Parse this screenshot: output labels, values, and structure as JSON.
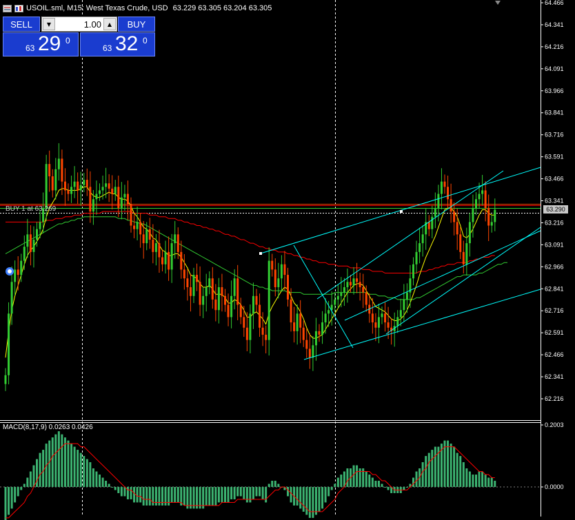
{
  "header": {
    "symbol_line": "USOIL.sml, M15:  West Texas Crude, USD",
    "ohlc": "63.229 63.305 63.204 63.305",
    "icons": [
      "one-click-trading-icon",
      "symbol-icon"
    ]
  },
  "trade_panel": {
    "sell_label": "SELL",
    "buy_label": "BUY",
    "lot_value": "1.00",
    "sell_price_small": "63",
    "sell_price_big": "29",
    "sell_price_sup": "0",
    "buy_price_small": "63",
    "buy_price_big": "32",
    "buy_price_sup": "0"
  },
  "position_label": "BUY 1 at 63.269",
  "current_price_tag": "63.290",
  "macd_label": "MACD(8,17,9) 0.0263 0.0426",
  "colors": {
    "bull": "#32cd32",
    "bear": "#ff4500",
    "ma_fast": "#ffff00",
    "ma_mid": "#ff0000",
    "ma_slow": "#32cd32",
    "trendline": "#00ffff",
    "panel_blue": "#1a3ccf"
  },
  "chart_data": [
    {
      "type": "candlestick",
      "title": "USOIL.sml, M15",
      "y_ticks": [
        "64.466",
        "64.341",
        "64.216",
        "64.091",
        "63.966",
        "63.841",
        "63.716",
        "63.591",
        "63.466",
        "63.341",
        "63.216",
        "63.091",
        "62.966",
        "62.841",
        "62.716",
        "62.591",
        "62.466",
        "62.341",
        "62.216"
      ],
      "ylim": [
        62.19,
        64.47
      ],
      "closes": [
        62.35,
        62.7,
        62.88,
        62.95,
        62.92,
        63.0,
        63.08,
        63.15,
        63.05,
        63.12,
        63.18,
        63.22,
        63.3,
        63.55,
        63.48,
        63.4,
        63.52,
        63.58,
        63.45,
        63.4,
        63.38,
        63.42,
        63.45,
        63.4,
        63.43,
        63.46,
        63.42,
        63.28,
        63.35,
        63.38,
        63.4,
        63.42,
        63.44,
        63.41,
        63.38,
        63.42,
        63.3,
        63.36,
        63.38,
        63.32,
        63.2,
        63.18,
        63.22,
        63.15,
        63.1,
        63.18,
        63.12,
        63.05,
        63.1,
        63.02,
        62.98,
        63.05,
        62.95,
        63.1,
        63.15,
        63.05,
        62.95,
        62.9,
        62.85,
        62.8,
        62.92,
        62.88,
        62.75,
        62.8,
        62.85,
        62.9,
        62.78,
        62.72,
        62.85,
        62.8,
        62.75,
        62.68,
        62.8,
        62.9,
        62.75,
        62.68,
        62.62,
        62.55,
        62.7,
        62.8,
        62.75,
        62.62,
        62.58,
        62.55,
        63.0,
        62.95,
        62.85,
        62.9,
        62.98,
        62.92,
        62.78,
        62.65,
        62.6,
        62.7,
        62.62,
        62.55,
        62.5,
        62.45,
        62.52,
        62.6,
        62.58,
        62.65,
        62.7,
        62.72,
        62.75,
        62.78,
        62.8,
        62.82,
        62.85,
        62.88,
        62.86,
        62.9,
        62.88,
        62.85,
        62.82,
        62.75,
        62.7,
        62.65,
        62.62,
        62.68,
        62.7,
        62.65,
        62.62,
        62.6,
        62.63,
        62.68,
        62.72,
        62.78,
        62.82,
        62.9,
        62.98,
        63.05,
        63.1,
        63.15,
        63.22,
        63.18,
        63.25,
        63.3,
        63.38,
        63.45,
        63.42,
        63.35,
        63.28,
        63.22,
        63.15,
        63.05,
        62.98,
        63.1,
        63.22,
        63.3,
        63.35,
        63.38,
        63.4,
        63.3,
        63.2,
        63.22,
        63.29
      ],
      "ma_fast": [
        62.45,
        62.6,
        62.72,
        62.8,
        62.86,
        62.92,
        62.98,
        63.03,
        63.06,
        63.08,
        63.11,
        63.14,
        63.18,
        63.25,
        63.3,
        63.33,
        63.36,
        63.4,
        63.41,
        63.41,
        63.4,
        63.4,
        63.4,
        63.4,
        63.41,
        63.42,
        63.42,
        63.39,
        63.37,
        63.36,
        63.36,
        63.37,
        63.38,
        63.39,
        63.38,
        63.38,
        63.36,
        63.35,
        63.35,
        63.34,
        63.31,
        63.27,
        63.25,
        63.22,
        63.19,
        63.18,
        63.16,
        63.13,
        63.12,
        63.09,
        63.06,
        63.05,
        63.03,
        63.03,
        63.04,
        63.04,
        63.02,
        62.99,
        62.96,
        62.92,
        62.91,
        62.9,
        62.87,
        62.85,
        62.85,
        62.86,
        62.84,
        62.81,
        62.81,
        62.81,
        62.79,
        62.76,
        62.76,
        62.78,
        62.77,
        62.75,
        62.72,
        62.68,
        62.68,
        62.7,
        62.71,
        62.69,
        62.67,
        62.64,
        62.7,
        62.74,
        62.77,
        62.8,
        62.83,
        62.85,
        62.84,
        62.8,
        62.76,
        62.74,
        62.71,
        62.67,
        62.62,
        62.58,
        62.56,
        62.56,
        62.57,
        62.58,
        62.61,
        62.64,
        62.67,
        62.7,
        62.73,
        62.76,
        62.79,
        62.82,
        62.84,
        62.86,
        62.87,
        62.87,
        62.86,
        62.83,
        62.8,
        62.77,
        62.74,
        62.73,
        62.72,
        62.71,
        62.69,
        62.67,
        62.66,
        62.66,
        62.67,
        62.69,
        62.72,
        62.76,
        62.81,
        62.86,
        62.92,
        62.97,
        63.02,
        63.06,
        63.1,
        63.14,
        63.19,
        63.24,
        63.29,
        63.3,
        63.3,
        63.28,
        63.25,
        63.2,
        63.14,
        63.13,
        63.15,
        63.18,
        63.22,
        63.26,
        63.29,
        63.29,
        63.27,
        63.26,
        63.26
      ],
      "ma_mid": [
        63.22,
        63.22,
        63.22,
        63.22,
        63.22,
        63.22,
        63.22,
        63.22,
        63.22,
        63.22,
        63.22,
        63.22,
        63.22,
        63.23,
        63.23,
        63.23,
        63.24,
        63.24,
        63.24,
        63.25,
        63.25,
        63.25,
        63.26,
        63.26,
        63.26,
        63.27,
        63.27,
        63.27,
        63.27,
        63.27,
        63.27,
        63.28,
        63.28,
        63.28,
        63.28,
        63.28,
        63.28,
        63.28,
        63.28,
        63.28,
        63.28,
        63.27,
        63.27,
        63.27,
        63.27,
        63.27,
        63.26,
        63.26,
        63.26,
        63.25,
        63.25,
        63.25,
        63.24,
        63.24,
        63.24,
        63.23,
        63.23,
        63.22,
        63.22,
        63.21,
        63.21,
        63.2,
        63.2,
        63.19,
        63.19,
        63.18,
        63.18,
        63.17,
        63.17,
        63.16,
        63.15,
        63.15,
        63.14,
        63.14,
        63.13,
        63.12,
        63.12,
        63.11,
        63.1,
        63.1,
        63.09,
        63.08,
        63.08,
        63.07,
        63.07,
        63.06,
        63.06,
        63.05,
        63.05,
        63.05,
        63.04,
        63.04,
        63.03,
        63.03,
        63.02,
        63.02,
        63.01,
        63.01,
        63.0,
        63.0,
        62.99,
        62.99,
        62.99,
        62.98,
        62.98,
        62.98,
        62.97,
        62.97,
        62.97,
        62.97,
        62.96,
        62.96,
        62.96,
        62.96,
        62.95,
        62.95,
        62.95,
        62.94,
        62.94,
        62.94,
        62.94,
        62.93,
        62.93,
        62.93,
        62.93,
        62.93,
        62.93,
        62.93,
        62.93,
        62.93,
        62.93,
        62.93,
        62.94,
        62.94,
        62.94,
        62.95,
        62.95,
        62.96,
        62.96,
        62.97,
        62.97,
        62.98,
        62.98,
        62.98,
        62.99,
        62.99,
        62.99,
        62.99,
        63.0,
        63.0,
        63.01,
        63.01,
        63.02,
        63.02,
        63.02,
        63.03,
        63.03
      ],
      "ma_slow": [
        63.04,
        63.05,
        63.06,
        63.07,
        63.08,
        63.09,
        63.1,
        63.11,
        63.12,
        63.13,
        63.14,
        63.15,
        63.16,
        63.17,
        63.18,
        63.19,
        63.2,
        63.21,
        63.21,
        63.22,
        63.22,
        63.23,
        63.23,
        63.24,
        63.24,
        63.25,
        63.25,
        63.25,
        63.25,
        63.25,
        63.25,
        63.25,
        63.25,
        63.25,
        63.25,
        63.25,
        63.24,
        63.24,
        63.24,
        63.23,
        63.23,
        63.22,
        63.22,
        63.21,
        63.21,
        63.2,
        63.19,
        63.18,
        63.17,
        63.16,
        63.15,
        63.14,
        63.13,
        63.12,
        63.11,
        63.1,
        63.09,
        63.08,
        63.07,
        63.06,
        63.05,
        63.04,
        63.03,
        63.02,
        63.01,
        63.0,
        62.99,
        62.98,
        62.97,
        62.96,
        62.95,
        62.94,
        62.93,
        62.92,
        62.91,
        62.9,
        62.89,
        62.88,
        62.87,
        62.86,
        62.86,
        62.85,
        62.85,
        62.84,
        62.84,
        62.83,
        62.83,
        62.83,
        62.83,
        62.83,
        62.82,
        62.82,
        62.82,
        62.82,
        62.82,
        62.81,
        62.81,
        62.81,
        62.81,
        62.81,
        62.81,
        62.81,
        62.81,
        62.81,
        62.81,
        62.82,
        62.82,
        62.82,
        62.82,
        62.82,
        62.82,
        62.82,
        62.82,
        62.82,
        62.82,
        62.82,
        62.81,
        62.81,
        62.81,
        62.8,
        62.8,
        62.8,
        62.79,
        62.79,
        62.79,
        62.78,
        62.78,
        62.78,
        62.78,
        62.78,
        62.78,
        62.79,
        62.79,
        62.8,
        62.81,
        62.82,
        62.83,
        62.84,
        62.85,
        62.86,
        62.87,
        62.88,
        62.89,
        62.9,
        62.91,
        62.91,
        62.92,
        62.92,
        62.92,
        62.92,
        62.92,
        62.93,
        62.93,
        62.94,
        62.95,
        62.96,
        62.97,
        62.98,
        62.98,
        62.99,
        62.99
      ]
    },
    {
      "type": "bar",
      "title": "MACD(8,17,9)",
      "y_ticks": [
        "0.2003",
        "0.0000"
      ],
      "ylim": [
        -0.12,
        0.2003
      ],
      "hist": [
        -0.11,
        -0.09,
        -0.07,
        -0.05,
        -0.03,
        -0.01,
        0.01,
        0.03,
        0.05,
        0.07,
        0.09,
        0.11,
        0.12,
        0.14,
        0.15,
        0.16,
        0.17,
        0.18,
        0.17,
        0.16,
        0.15,
        0.14,
        0.13,
        0.12,
        0.11,
        0.1,
        0.09,
        0.08,
        0.06,
        0.05,
        0.04,
        0.03,
        0.02,
        0.01,
        0.0,
        -0.01,
        -0.02,
        -0.03,
        -0.03,
        -0.04,
        -0.04,
        -0.05,
        -0.05,
        -0.05,
        -0.06,
        -0.06,
        -0.06,
        -0.06,
        -0.06,
        -0.06,
        -0.06,
        -0.06,
        -0.06,
        -0.05,
        -0.05,
        -0.05,
        -0.06,
        -0.06,
        -0.07,
        -0.07,
        -0.07,
        -0.07,
        -0.07,
        -0.07,
        -0.06,
        -0.06,
        -0.06,
        -0.06,
        -0.05,
        -0.05,
        -0.05,
        -0.05,
        -0.04,
        -0.04,
        -0.03,
        -0.03,
        -0.04,
        -0.05,
        -0.05,
        -0.04,
        -0.03,
        -0.03,
        -0.04,
        -0.05,
        0.01,
        0.02,
        0.02,
        0.01,
        0.0,
        -0.01,
        -0.03,
        -0.05,
        -0.06,
        -0.06,
        -0.07,
        -0.08,
        -0.09,
        -0.1,
        -0.1,
        -0.09,
        -0.08,
        -0.07,
        -0.05,
        -0.03,
        -0.01,
        0.01,
        0.03,
        0.04,
        0.05,
        0.06,
        0.06,
        0.07,
        0.07,
        0.06,
        0.06,
        0.05,
        0.04,
        0.03,
        0.02,
        0.02,
        0.01,
        0.0,
        -0.01,
        -0.02,
        -0.02,
        -0.02,
        -0.02,
        -0.01,
        0.0,
        0.01,
        0.03,
        0.05,
        0.06,
        0.08,
        0.1,
        0.11,
        0.12,
        0.13,
        0.13,
        0.14,
        0.15,
        0.15,
        0.14,
        0.13,
        0.11,
        0.1,
        0.08,
        0.06,
        0.05,
        0.04,
        0.04,
        0.05,
        0.05,
        0.04,
        0.03,
        0.03,
        0.02
      ],
      "signal": [
        -0.1,
        -0.1,
        -0.09,
        -0.08,
        -0.07,
        -0.06,
        -0.05,
        -0.03,
        -0.02,
        0.0,
        0.02,
        0.04,
        0.05,
        0.07,
        0.08,
        0.1,
        0.11,
        0.12,
        0.13,
        0.14,
        0.14,
        0.14,
        0.14,
        0.14,
        0.13,
        0.13,
        0.12,
        0.11,
        0.1,
        0.09,
        0.08,
        0.07,
        0.06,
        0.05,
        0.04,
        0.03,
        0.02,
        0.01,
        0.0,
        -0.01,
        -0.01,
        -0.02,
        -0.03,
        -0.03,
        -0.04,
        -0.04,
        -0.04,
        -0.05,
        -0.05,
        -0.05,
        -0.05,
        -0.05,
        -0.05,
        -0.05,
        -0.05,
        -0.05,
        -0.05,
        -0.06,
        -0.06,
        -0.06,
        -0.06,
        -0.06,
        -0.06,
        -0.06,
        -0.06,
        -0.06,
        -0.06,
        -0.06,
        -0.06,
        -0.05,
        -0.05,
        -0.05,
        -0.05,
        -0.05,
        -0.04,
        -0.04,
        -0.04,
        -0.04,
        -0.04,
        -0.04,
        -0.04,
        -0.04,
        -0.04,
        -0.04,
        -0.03,
        -0.02,
        -0.01,
        -0.01,
        0.0,
        0.0,
        -0.01,
        -0.02,
        -0.03,
        -0.04,
        -0.05,
        -0.06,
        -0.07,
        -0.08,
        -0.08,
        -0.08,
        -0.08,
        -0.08,
        -0.07,
        -0.06,
        -0.05,
        -0.04,
        -0.02,
        -0.01,
        0.0,
        0.02,
        0.03,
        0.04,
        0.05,
        0.05,
        0.05,
        0.05,
        0.05,
        0.04,
        0.04,
        0.03,
        0.02,
        0.02,
        0.01,
        0.0,
        -0.01,
        -0.01,
        -0.01,
        -0.01,
        -0.01,
        0.0,
        0.01,
        0.02,
        0.03,
        0.05,
        0.06,
        0.08,
        0.09,
        0.1,
        0.11,
        0.12,
        0.13,
        0.13,
        0.13,
        0.13,
        0.12,
        0.11,
        0.1,
        0.09,
        0.08,
        0.07,
        0.06,
        0.05,
        0.05,
        0.04,
        0.04,
        0.03,
        0.03
      ]
    }
  ]
}
